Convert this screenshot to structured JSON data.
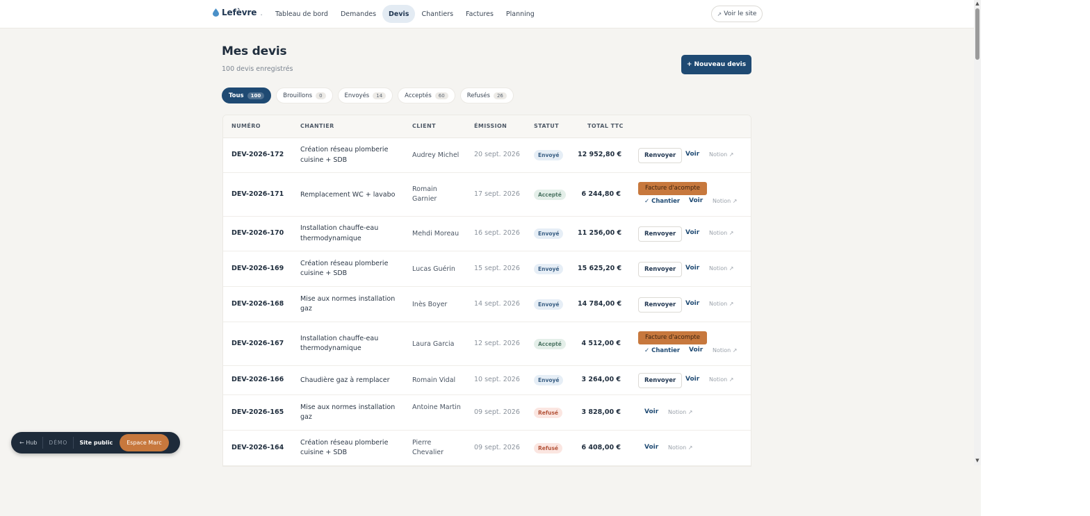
{
  "brand": {
    "name": "Lefèvre",
    "dot": "."
  },
  "nav": [
    {
      "label": "Tableau de bord",
      "active": false
    },
    {
      "label": "Demandes",
      "active": false
    },
    {
      "label": "Devis",
      "active": true
    },
    {
      "label": "Chantiers",
      "active": false
    },
    {
      "label": "Factures",
      "active": false
    },
    {
      "label": "Planning",
      "active": false
    }
  ],
  "header_actions": {
    "view_site_label": "Voir le site",
    "view_site_icon": "↗"
  },
  "page": {
    "title": "Mes devis",
    "subtitle": "100 devis enregistrés",
    "new_button": "+ Nouveau devis"
  },
  "filters": [
    {
      "label": "Tous",
      "count": "100",
      "active": true
    },
    {
      "label": "Brouillons",
      "count": "0",
      "active": false
    },
    {
      "label": "Envoyés",
      "count": "14",
      "active": false
    },
    {
      "label": "Acceptés",
      "count": "60",
      "active": false
    },
    {
      "label": "Refusés",
      "count": "26",
      "active": false
    }
  ],
  "table": {
    "columns": [
      "NUMÉRO",
      "CHANTIER",
      "CLIENT",
      "ÉMISSION",
      "STATUT",
      "TOTAL TTC"
    ],
    "rows": [
      {
        "numero": "DEV-2026-172",
        "chantier": "Création réseau plomberie cuisine + SDB",
        "client": "Audrey Michel",
        "emission": "20 sept. 2026",
        "statut": "Envoyé",
        "total": "12 952,80 €",
        "kind": "envoye"
      },
      {
        "numero": "DEV-2026-171",
        "chantier": "Remplacement WC + lavabo",
        "client": "Romain Garnier",
        "emission": "17 sept. 2026",
        "statut": "Accepté",
        "total": "6 244,80 €",
        "kind": "accepte"
      },
      {
        "numero": "DEV-2026-170",
        "chantier": "Installation chauffe-eau thermodynamique",
        "client": "Mehdi Moreau",
        "emission": "16 sept. 2026",
        "statut": "Envoyé",
        "total": "11 256,00 €",
        "kind": "envoye"
      },
      {
        "numero": "DEV-2026-169",
        "chantier": "Création réseau plomberie cuisine + SDB",
        "client": "Lucas Guérin",
        "emission": "15 sept. 2026",
        "statut": "Envoyé",
        "total": "15 625,20 €",
        "kind": "envoye"
      },
      {
        "numero": "DEV-2026-168",
        "chantier": "Mise aux normes installation gaz",
        "client": "Inès Boyer",
        "emission": "14 sept. 2026",
        "statut": "Envoyé",
        "total": "14 784,00 €",
        "kind": "envoye"
      },
      {
        "numero": "DEV-2026-167",
        "chantier": "Installation chauffe-eau thermodynamique",
        "client": "Laura Garcia",
        "emission": "12 sept. 2026",
        "statut": "Accepté",
        "total": "4 512,00 €",
        "kind": "accepte"
      },
      {
        "numero": "DEV-2026-166",
        "chantier": "Chaudière gaz à remplacer",
        "client": "Romain Vidal",
        "emission": "10 sept. 2026",
        "statut": "Envoyé",
        "total": "3 264,00 €",
        "kind": "envoye"
      },
      {
        "numero": "DEV-2026-165",
        "chantier": "Mise aux normes installation gaz",
        "client": "Antoine Martin",
        "emission": "09 sept. 2026",
        "statut": "Refusé",
        "total": "3 828,00 €",
        "kind": "refuse"
      },
      {
        "numero": "DEV-2026-164",
        "chantier": "Création réseau plomberie cuisine + SDB",
        "client": "Pierre Chevalier",
        "emission": "09 sept. 2026",
        "statut": "Refusé",
        "total": "6 408,00 €",
        "kind": "refuse"
      }
    ],
    "actions": {
      "renvoyer": "Renvoyer",
      "voir": "Voir",
      "notion": "Notion ↗",
      "facture_acompte": "Facture d'acompte",
      "chantier": "✓ Chantier"
    }
  },
  "floating_bar": {
    "hub": "← Hub",
    "demo": "DÉMO",
    "site_public": "Site public",
    "espace": "Espace Marc"
  },
  "colors": {
    "primary": "#1f4a73",
    "accent": "#c7783d",
    "background": "#f5f4f1"
  }
}
